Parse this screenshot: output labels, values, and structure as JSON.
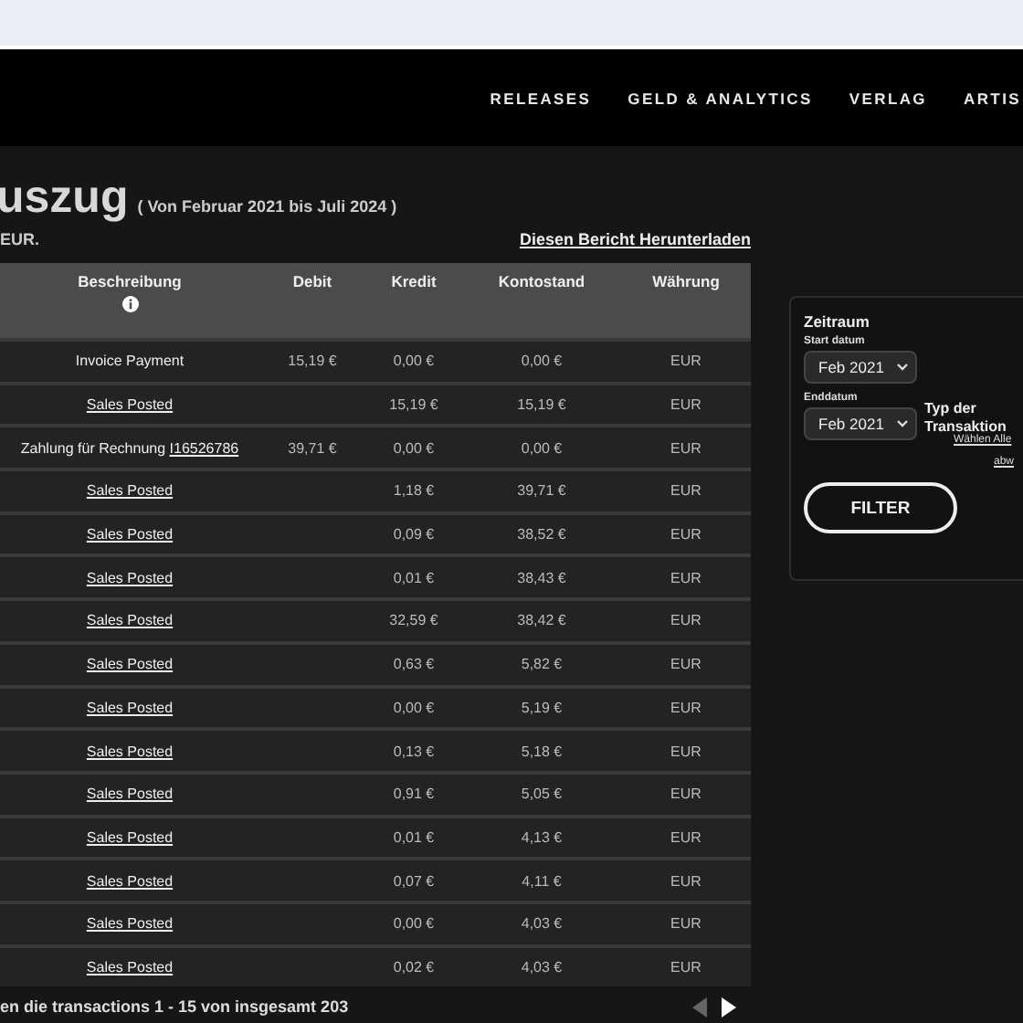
{
  "nav": {
    "items": [
      "RELEASES",
      "GELD & ANALYTICS",
      "VERLAG",
      "ARTIS"
    ]
  },
  "statement": {
    "title": "uszug",
    "period": "( Von Februar 2021 bis Juli 2024 )",
    "currency_note": "EUR.",
    "download_link": "Diesen Bericht Herunterladen"
  },
  "table": {
    "columns": [
      "Beschreibung",
      "Debit",
      "Kredit",
      "Kontostand",
      "Währung"
    ],
    "rows": [
      {
        "description": "Invoice Payment",
        "link": false,
        "debit": "15,19 €",
        "kredit": "0,00 €",
        "kontostand": "0,00 €",
        "waehrung": "EUR"
      },
      {
        "description": "Sales Posted",
        "link": true,
        "kredit": "15,19 €",
        "kontostand": "15,19 €",
        "waehrung": "EUR"
      },
      {
        "description": "Zahlung für Rechnung ",
        "invoice": "I16526786",
        "link": false,
        "debit": "39,71 €",
        "kredit": "0,00 €",
        "kontostand": "0,00 €",
        "waehrung": "EUR"
      },
      {
        "description": "Sales Posted",
        "link": true,
        "kredit": "1,18 €",
        "kontostand": "39,71 €",
        "waehrung": "EUR"
      },
      {
        "description": "Sales Posted",
        "link": true,
        "kredit": "0,09 €",
        "kontostand": "38,52 €",
        "waehrung": "EUR"
      },
      {
        "description": "Sales Posted",
        "link": true,
        "kredit": "0,01 €",
        "kontostand": "38,43 €",
        "waehrung": "EUR"
      },
      {
        "description": "Sales Posted",
        "link": true,
        "kredit": "32,59 €",
        "kontostand": "38,42 €",
        "waehrung": "EUR"
      },
      {
        "description": "Sales Posted",
        "link": true,
        "kredit": "0,63 €",
        "kontostand": "5,82 €",
        "waehrung": "EUR"
      },
      {
        "description": "Sales Posted",
        "link": true,
        "kredit": "0,00 €",
        "kontostand": "5,19 €",
        "waehrung": "EUR"
      },
      {
        "description": "Sales Posted",
        "link": true,
        "kredit": "0,13 €",
        "kontostand": "5,18 €",
        "waehrung": "EUR"
      },
      {
        "description": "Sales Posted",
        "link": true,
        "kredit": "0,91 €",
        "kontostand": "5,05 €",
        "waehrung": "EUR"
      },
      {
        "description": "Sales Posted",
        "link": true,
        "kredit": "0,01 €",
        "kontostand": "4,13 €",
        "waehrung": "EUR"
      },
      {
        "description": "Sales Posted",
        "link": true,
        "kredit": "0,07 €",
        "kontostand": "4,11 €",
        "waehrung": "EUR"
      },
      {
        "description": "Sales Posted",
        "link": true,
        "kredit": "0,00 €",
        "kontostand": "4,03 €",
        "waehrung": "EUR"
      },
      {
        "description": "Sales Posted",
        "link": true,
        "kredit": "0,02 €",
        "kontostand": "4,03 €",
        "waehrung": "EUR"
      }
    ]
  },
  "pagination": {
    "summary": "en die transactions 1 - 15 von insgesamt 203",
    "previous_disabled": true,
    "next_disabled": false
  },
  "filter": {
    "title": "Zeitraum",
    "start_label": "Start datum",
    "start_value": "Feb 2021",
    "end_label": "Enddatum",
    "end_value": "Feb 2021",
    "type_label": "Typ der Transaktion",
    "select_all": "Wählen Alle",
    "deselect": "abw",
    "button": "FILTER"
  }
}
